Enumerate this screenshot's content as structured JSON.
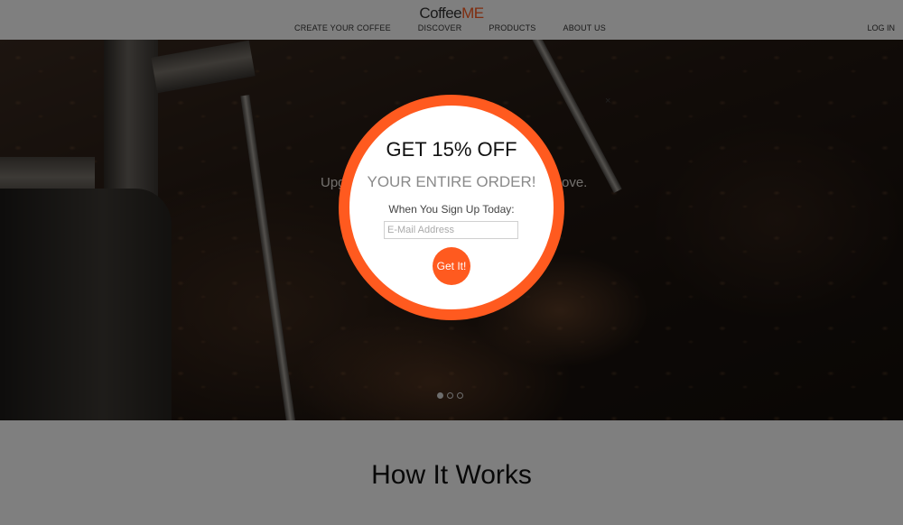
{
  "header": {
    "logo_prefix": "Coffee",
    "logo_suffix": "ME",
    "nav": [
      "CREATE YOUR COFFEE",
      "DISCOVER",
      "PRODUCTS",
      "ABOUT US"
    ],
    "login": "LOG IN"
  },
  "hero": {
    "text_fragment_left": "Upg",
    "text_fragment_right": "ove.",
    "slides": 3,
    "active_slide": 1
  },
  "section": {
    "title": "How It Works"
  },
  "modal": {
    "close": "×",
    "title": "GET 15% OFF",
    "subtitle": "YOUR ENTIRE ORDER!",
    "caption": "When You Sign Up Today:",
    "email_placeholder": "E-Mail Address",
    "email_value": "",
    "button_label": "Get It!"
  },
  "colors": {
    "accent": "#ff5a1f",
    "overlay": "rgba(0,0,0,0.5)"
  }
}
